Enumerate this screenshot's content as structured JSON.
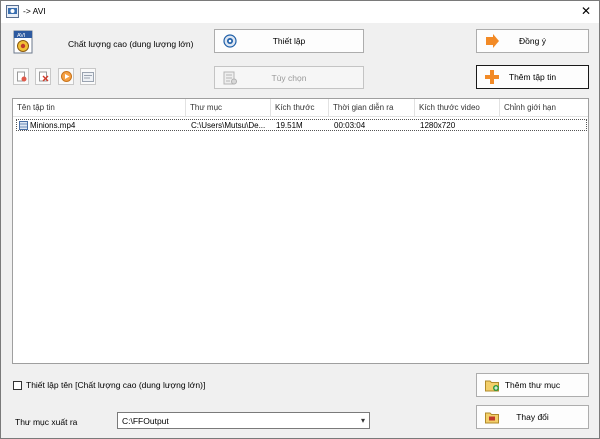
{
  "window": {
    "title": "-> AVI",
    "close_glyph": "✕"
  },
  "profile": {
    "format_badge": "AVI",
    "label": "Chất lượng cao (dung lượng lớn)"
  },
  "buttons": {
    "settings": "Thiết lập",
    "options": "Tùy chọn",
    "ok": "Đồng ý",
    "add_file": "Thêm tập tin",
    "add_folder": "Thêm thư mục",
    "change": "Thay đổi"
  },
  "toolbar": {
    "icons": [
      "remove-file-icon",
      "clear-list-icon",
      "play-icon",
      "media-info-icon"
    ]
  },
  "file_list": {
    "columns": [
      "Tên tập tin",
      "Thư mục",
      "Kích thước",
      "Thời gian diễn ra",
      "Kích thước video",
      "Chỉnh giới hạn"
    ],
    "rows": [
      {
        "name": "Minions.mp4",
        "folder": "C:\\Users\\Mutsu\\De...",
        "size": "19.51M",
        "duration": "00:03:04",
        "video_size": "1280x720",
        "limit": ""
      }
    ]
  },
  "naming": {
    "checked": false,
    "label": "Thiết lập tên [Chất lượng cao (dung lượng lớn)]"
  },
  "output": {
    "label": "Thư mục xuất ra",
    "value": "C:\\FFOutput"
  },
  "colors": {
    "accent_orange": "#f28a26",
    "frame": "#f0f0f0",
    "blue_icon": "#1f5fa8"
  }
}
